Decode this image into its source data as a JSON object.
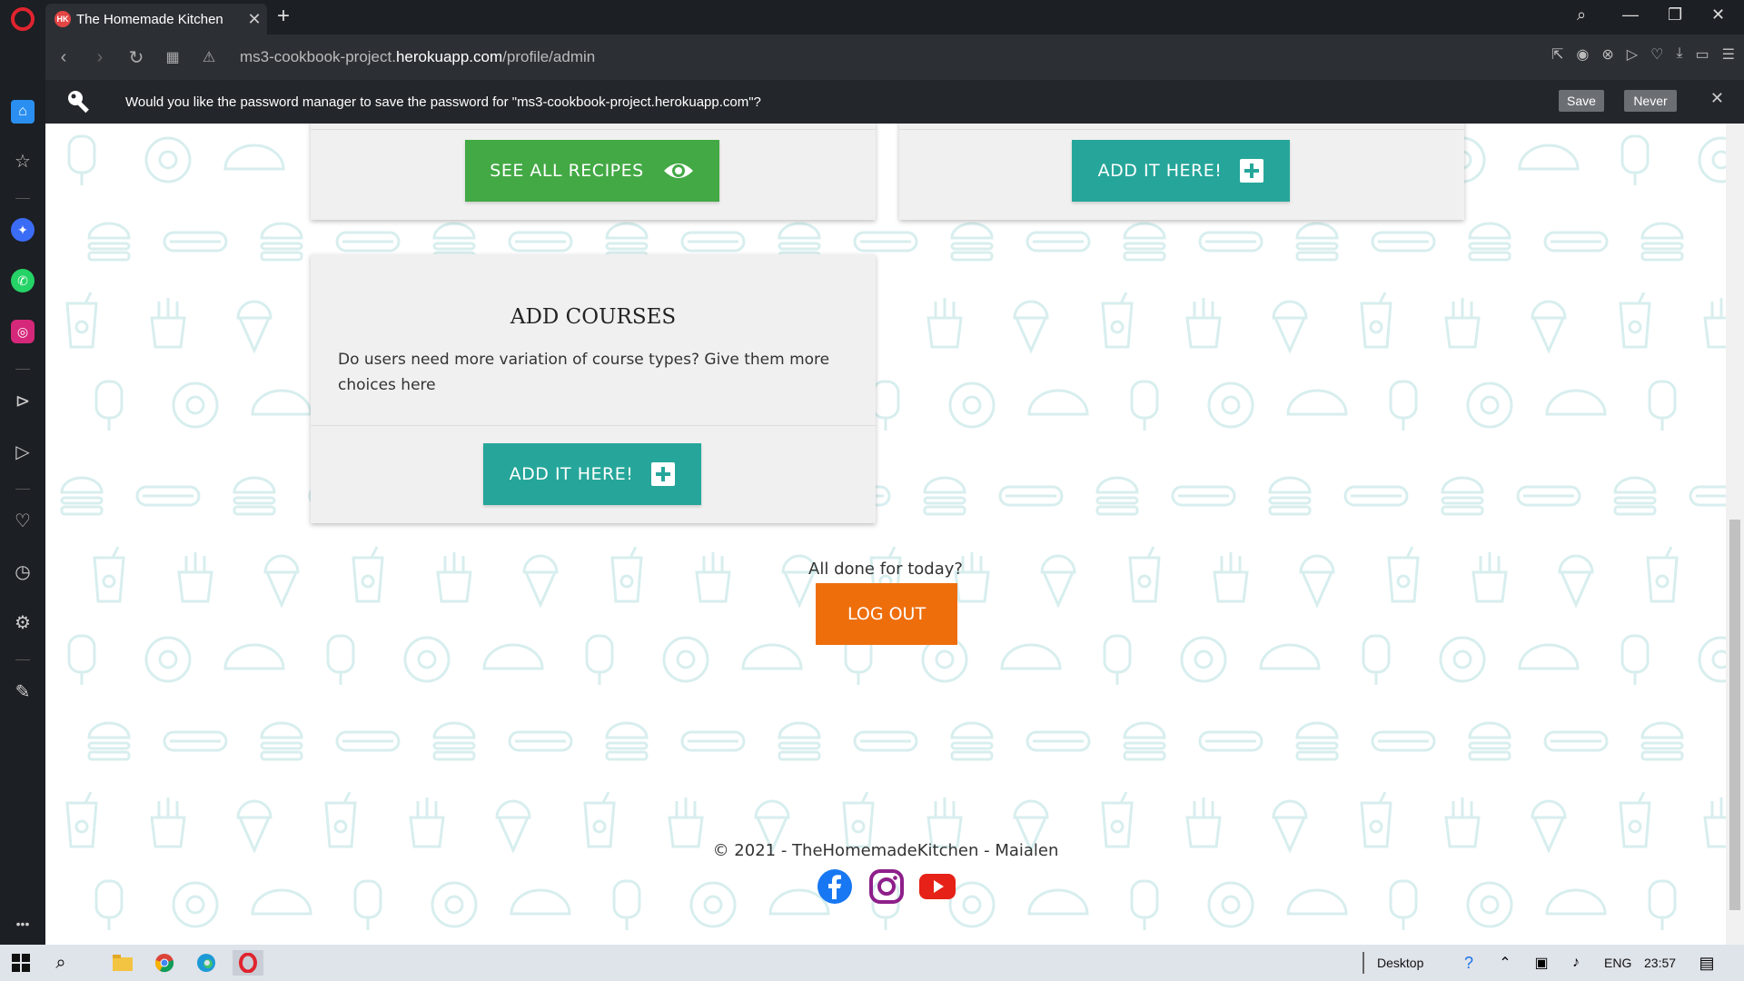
{
  "browser": {
    "tab_title": "The Homemade Kitchen",
    "tab_favicon_text": "HK",
    "url_prefix": "ms3-cookbook-project.",
    "url_domain": "herokuapp.com",
    "url_path": "/profile/admin"
  },
  "password_bar": {
    "message": "Would you like the password manager to save the password for \"ms3-cookbook-project.herokuapp.com\"?",
    "save_label": "Save",
    "never_label": "Never"
  },
  "cards": {
    "recipes": {
      "button_label": "SEE ALL RECIPES",
      "icon": "eye-icon",
      "color": "#43a945"
    },
    "top_right": {
      "button_label": "ADD IT HERE!",
      "icon": "plus-square-icon",
      "color": "#26a69a"
    },
    "courses": {
      "title": "ADD COURSES",
      "text": "Do users need more variation of course types? Give them more choices here",
      "button_label": "ADD IT HERE!",
      "icon": "plus-square-icon",
      "color": "#26a69a"
    }
  },
  "logout": {
    "prompt": "All done for today?",
    "button_label": "LOG OUT",
    "color": "#ee6e0c"
  },
  "footer": {
    "text": "© 2021 - TheHomemadeKitchen - Maialen",
    "social": [
      "facebook-icon",
      "instagram-icon",
      "youtube-icon"
    ]
  },
  "taskbar": {
    "desktop_label": "Desktop",
    "language": "ENG",
    "time": "23:57"
  },
  "colors": {
    "pattern": "#d8eeee",
    "teal": "#26a69a",
    "green": "#43a945",
    "orange": "#ee6e0c"
  }
}
